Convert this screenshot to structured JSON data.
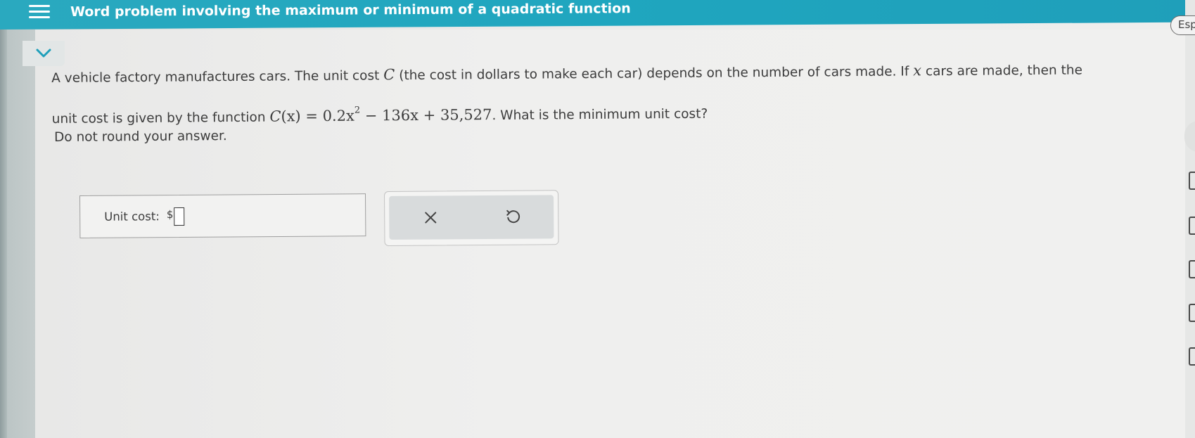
{
  "header": {
    "title": "Word problem involving the maximum or minimum of a quadratic function",
    "menu_icon": "hamburger-menu-icon"
  },
  "language_button": {
    "label": "Esp"
  },
  "collapse_icon": "chevron-down-icon",
  "problem": {
    "text_part1": "A vehicle factory manufactures cars. The unit cost ",
    "var_C": "C",
    "text_part2": " (the cost in dollars to make each car) depends on the number of cars made. If ",
    "var_x": "x",
    "text_part3": " cars are made, then the",
    "text_part4": "unit cost is given by the function ",
    "function_lhs": "C",
    "function_arg": "(x)",
    "function_eq": " = 0.2x",
    "function_exp": "2",
    "function_rest": " − 136x + 35,527",
    "text_part5": ". What is the minimum unit cost?",
    "instruction": "Do not round your answer."
  },
  "answer": {
    "label": "Unit cost:",
    "currency": "$",
    "value": ""
  },
  "actions": {
    "clear_icon": "x-clear-icon",
    "undo_icon": "undo-icon"
  },
  "colors": {
    "header_bg": "#1fa6bf",
    "header_text": "#ffffff",
    "body_text": "#3c3c3c",
    "panel_bg": "#d8dbdc"
  }
}
